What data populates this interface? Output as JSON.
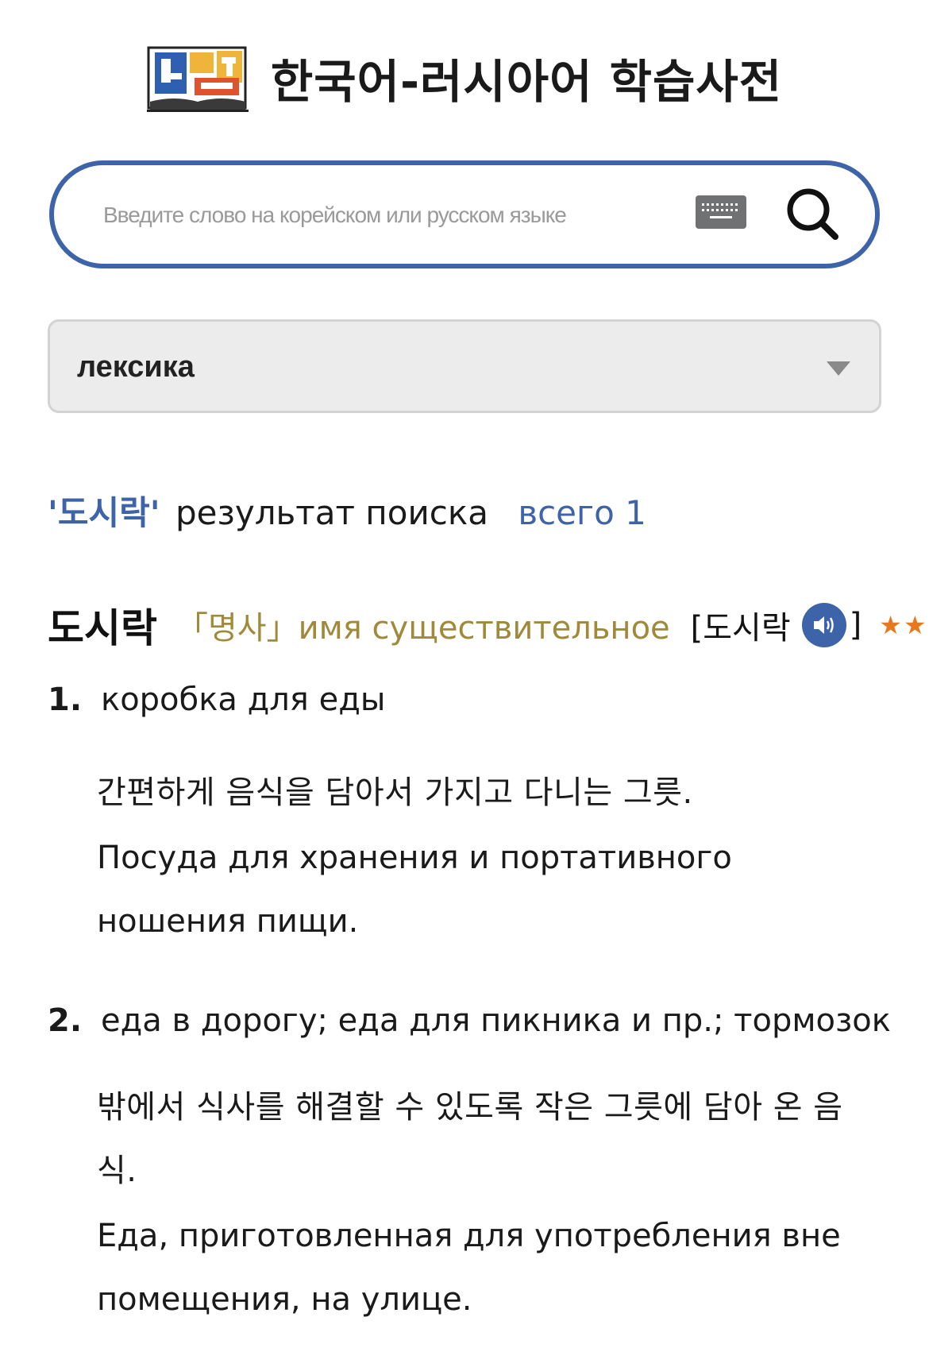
{
  "header": {
    "site_title": "한국어-러시아어 학습사전"
  },
  "search": {
    "placeholder": "Введите слово на корейском или русском языке",
    "value": ""
  },
  "category": {
    "selected": "лексика"
  },
  "results": {
    "query_quoted": "'도시락'",
    "summary_label": "результат поиска",
    "total_label": "всего 1"
  },
  "entry": {
    "headword": "도시락",
    "pos": "「명사」имя существительное",
    "pron_open": "[도시락",
    "pron_close": "]",
    "stars": "★★",
    "senses": [
      {
        "number": "1.",
        "translation": "коробка для еды",
        "kr_definition": "간편하게 음식을 담아서 가지고 다니는 그릇.",
        "ru_definition": "Посуда для хранения и портативного ношения пищи."
      },
      {
        "number": "2.",
        "translation": "еда в дорогу; еда для пикника и пр.; тормозок",
        "kr_definition": "밖에서 식사를 해결할 수 있도록 작은 그릇에 담아 온 음식.",
        "ru_definition": "Еда, приготовленная для употребления вне помещения, на улице."
      }
    ]
  },
  "colors": {
    "brand_blue": "#3d63a8",
    "pos_gold": "#a08a3a",
    "star_orange": "#e8781d"
  },
  "icons": {
    "logo": "dictionary-logo-icon",
    "keyboard": "keyboard-icon",
    "search": "search-icon",
    "dropdown": "chevron-down-icon",
    "audio": "speaker-icon"
  }
}
